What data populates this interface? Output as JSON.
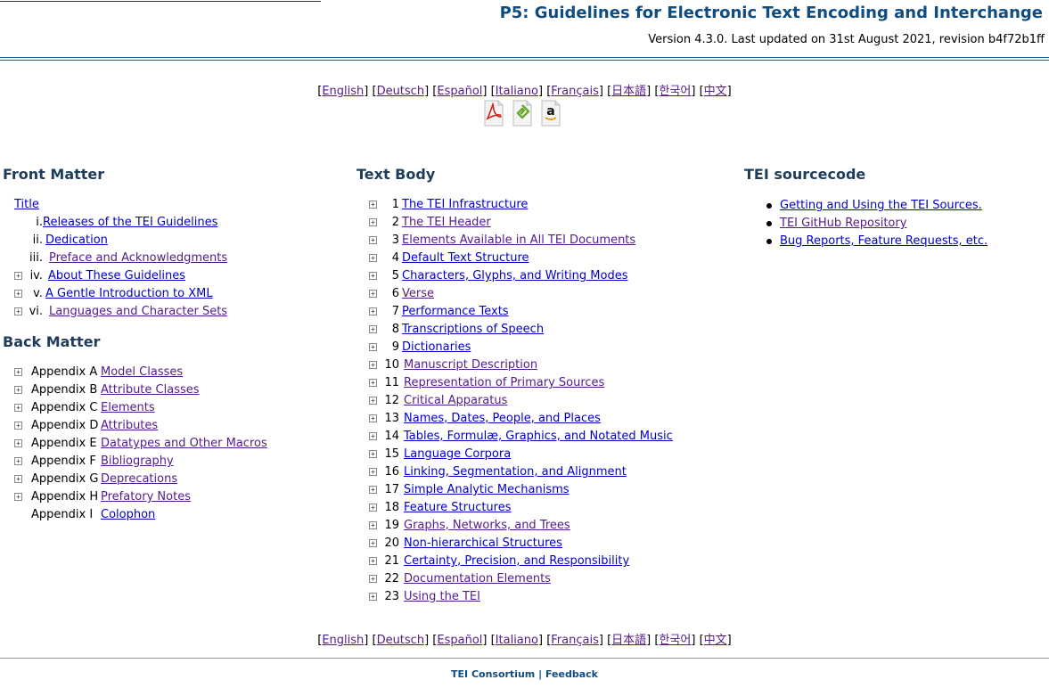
{
  "header": {
    "title": "P5: Guidelines for Electronic Text Encoding and Interchange",
    "version": "Version 4.3.0. Last updated on 31st August 2021, revision b4f72b1ff"
  },
  "languages": [
    "English",
    "Deutsch",
    "Español",
    "Italiano",
    "Français",
    "日本語",
    "한국어",
    "中文"
  ],
  "formats": [
    {
      "icon": "pdf-icon"
    },
    {
      "icon": "epub-icon"
    },
    {
      "icon": "amazon-icon"
    }
  ],
  "front_matter": {
    "heading": "Front Matter",
    "title_link": "Title",
    "items": [
      {
        "num": "i.",
        "label": "Releases of the TEI Guidelines",
        "expandable": false
      },
      {
        "num": "ii.",
        "label": "Dedication",
        "expandable": false
      },
      {
        "num": "iii.",
        "label": "Preface and Acknowledgments",
        "expandable": false
      },
      {
        "num": "iv.",
        "label": "About These Guidelines",
        "expandable": true
      },
      {
        "num": "v.",
        "label": "A Gentle Introduction to XML",
        "expandable": true
      },
      {
        "num": "vi.",
        "label": "Languages and Character Sets",
        "expandable": true
      }
    ]
  },
  "back_matter": {
    "heading": "Back Matter",
    "items": [
      {
        "num": "Appendix A",
        "label": "Model Classes",
        "expandable": true
      },
      {
        "num": "Appendix B",
        "label": "Attribute Classes",
        "expandable": true
      },
      {
        "num": "Appendix C",
        "label": "Elements",
        "expandable": true
      },
      {
        "num": "Appendix D",
        "label": "Attributes",
        "expandable": true
      },
      {
        "num": "Appendix E",
        "label": "Datatypes and Other Macros",
        "expandable": true
      },
      {
        "num": "Appendix F",
        "label": "Bibliography",
        "expandable": true
      },
      {
        "num": "Appendix G",
        "label": "Deprecations",
        "expandable": true
      },
      {
        "num": "Appendix H",
        "label": "Prefatory Notes",
        "expandable": true
      },
      {
        "num": "Appendix I",
        "label": "Colophon",
        "expandable": false
      }
    ]
  },
  "text_body": {
    "heading": "Text Body",
    "items": [
      {
        "num": "1",
        "label": "The TEI Infrastructure"
      },
      {
        "num": "2",
        "label": "The TEI Header"
      },
      {
        "num": "3",
        "label": "Elements Available in All TEI Documents"
      },
      {
        "num": "4",
        "label": "Default Text Structure"
      },
      {
        "num": "5",
        "label": "Characters, Glyphs, and Writing Modes"
      },
      {
        "num": "6",
        "label": "Verse"
      },
      {
        "num": "7",
        "label": "Performance Texts"
      },
      {
        "num": "8",
        "label": "Transcriptions of Speech"
      },
      {
        "num": "9",
        "label": "Dictionaries"
      },
      {
        "num": "10",
        "label": "Manuscript Description"
      },
      {
        "num": "11",
        "label": "Representation of Primary Sources"
      },
      {
        "num": "12",
        "label": "Critical Apparatus"
      },
      {
        "num": "13",
        "label": "Names, Dates, People, and Places"
      },
      {
        "num": "14",
        "label": "Tables, Formulæ, Graphics, and Notated Music"
      },
      {
        "num": "15",
        "label": "Language Corpora"
      },
      {
        "num": "16",
        "label": "Linking, Segmentation, and Alignment"
      },
      {
        "num": "17",
        "label": "Simple Analytic Mechanisms"
      },
      {
        "num": "18",
        "label": "Feature Structures"
      },
      {
        "num": "19",
        "label": "Graphs, Networks, and Trees"
      },
      {
        "num": "20",
        "label": "Non-hierarchical Structures"
      },
      {
        "num": "21",
        "label": "Certainty, Precision, and Responsibility"
      },
      {
        "num": "22",
        "label": "Documentation Elements"
      },
      {
        "num": "23",
        "label": "Using the TEI"
      }
    ]
  },
  "sourcecode": {
    "heading": "TEI sourcecode",
    "items": [
      "Getting and Using the TEI Sources.",
      "TEI GitHub Repository",
      "Bug Reports, Feature Requests, etc."
    ]
  },
  "footer": {
    "consortium": "TEI Consortium",
    "separator": "|",
    "feedback": "Feedback"
  }
}
